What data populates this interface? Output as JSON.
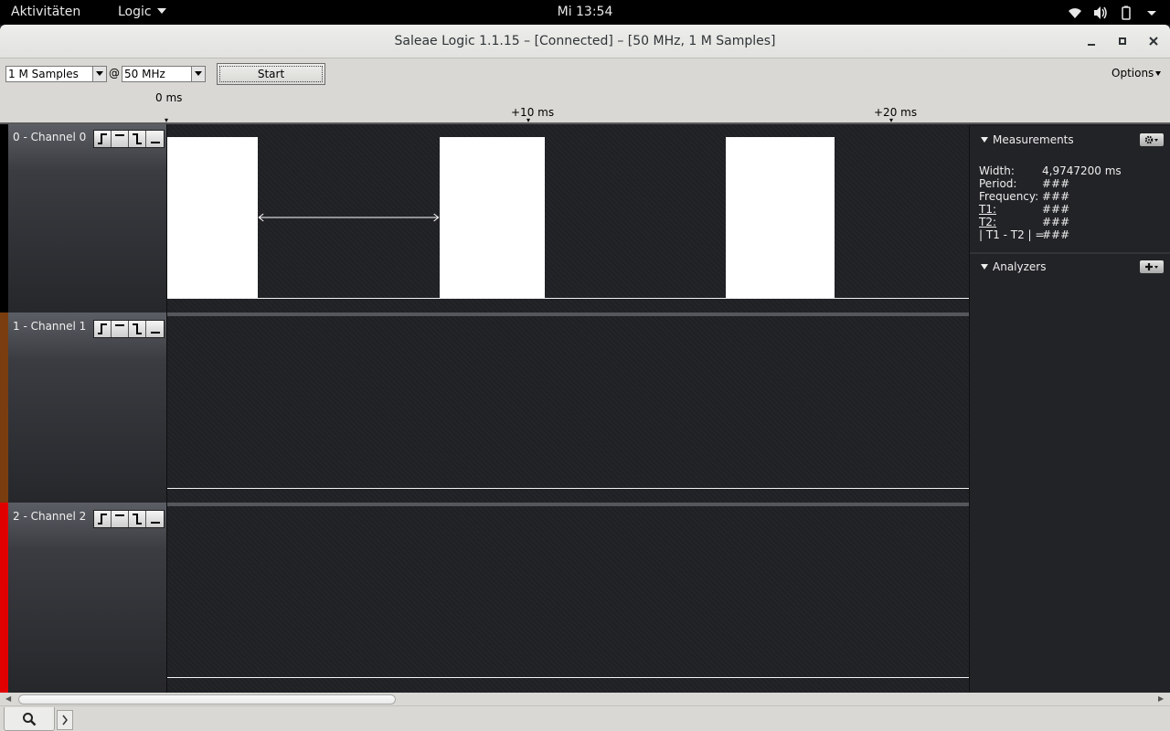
{
  "topbar": {
    "activities": "Aktivitäten",
    "app_menu": "Logic",
    "clock": "Mi 13:54",
    "tray_icons": [
      "wifi-icon",
      "volume-icon",
      "battery-icon",
      "system-menu-caret-icon"
    ]
  },
  "window": {
    "title": "Saleae Logic 1.1.15 – [Connected] – [50 MHz, 1 M Samples]"
  },
  "toolbar": {
    "samples_value": "1 M Samples",
    "at_sign": "@",
    "rate_value": "50 MHz",
    "start_label": "Start",
    "options_label": "Options"
  },
  "ruler": {
    "ticks": [
      "0 ms",
      "+10 ms",
      "+20 ms"
    ]
  },
  "channels": [
    {
      "name": "0 - Channel 0",
      "color": "#000000"
    },
    {
      "name": "1 - Channel 1",
      "color": "#7a3d10"
    },
    {
      "name": "2 - Channel 2",
      "color": "#e00000"
    }
  ],
  "channel0_pulses_ms": [
    {
      "start": 0.0,
      "end": 2.5
    },
    {
      "start": 7.5,
      "end": 10.4
    },
    {
      "start": 15.4,
      "end": 18.4
    }
  ],
  "timeline": {
    "visible_start_ms": 0,
    "visible_end_ms": 22.1
  },
  "panel": {
    "measurements_title": "Measurements",
    "rows": [
      {
        "key": "Width:",
        "value": "4,9747200 ms"
      },
      {
        "key": "Period:",
        "value": "###"
      },
      {
        "key": "Frequency:",
        "value": "###"
      },
      {
        "key": "T1:",
        "value": "###"
      },
      {
        "key": "T2:",
        "value": "###"
      },
      {
        "key": "| T1 - T2 | =",
        "value": "###"
      }
    ],
    "analyzers_title": "Analyzers"
  }
}
